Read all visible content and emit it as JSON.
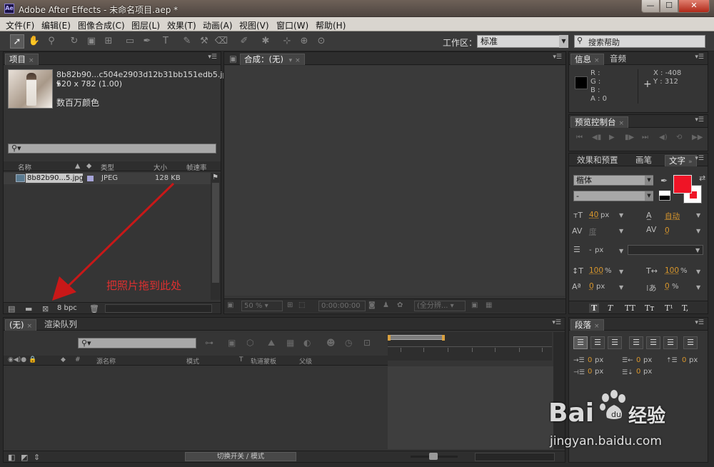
{
  "window": {
    "title": "Adobe After Effects - 未命名项目.aep *",
    "app_icon": "Ae",
    "min": "—",
    "max": "☐",
    "close": "✕"
  },
  "menu": [
    "文件(F)",
    "编辑(E)",
    "图像合成(C)",
    "图层(L)",
    "效果(T)",
    "动画(A)",
    "视图(V)",
    "窗口(W)",
    "帮助(H)"
  ],
  "toolbar": {
    "workspace_label": "工作区：",
    "workspace_value": "标准",
    "help_search": "搜索帮助"
  },
  "project": {
    "tab": "项目",
    "asset_name": "8b82b90...c504e2903d12b31bb151edb5.jpg ▾",
    "asset_dims": "520 x 782 (1.00)",
    "asset_color": "数百万颜色",
    "columns": [
      "名称",
      "类型",
      "大小",
      "帧速率"
    ],
    "row": {
      "name": "8b82b90...5.jpg",
      "type": "JPEG",
      "size": "128 KB"
    },
    "bpc": "8 bpc",
    "annotation": "把照片拖到此处",
    "annotation_color": "#c81818"
  },
  "comp": {
    "tab": "合成：(无)",
    "zoom": "50 %",
    "timecode": "0:00:00:00",
    "resolution": "(全分辨..."
  },
  "info": {
    "tab": "信息",
    "tab2": "音频",
    "r": "R :",
    "g": "G :",
    "b": "B :",
    "a": "A : 0",
    "x": "X : -408",
    "y": "Y : 312"
  },
  "preview": {
    "tab": "预览控制台"
  },
  "character": {
    "tab_effects": "效果和预置",
    "tab_brush": "画笔",
    "tab_text": "文字",
    "font": "楷体",
    "style": "-",
    "size_val": "40",
    "size_unit": "px",
    "leading_val": "自动",
    "kern_val": "度",
    "track_val": "0",
    "stroke_unit": "px",
    "vscale_val": "100",
    "vscale_unit": "%",
    "hscale_val": "100",
    "hscale_unit": "%",
    "baseline_val": "0",
    "baseline_unit": "px",
    "tsume_val": "0",
    "tsume_unit": "%",
    "styles": [
      "T",
      "T",
      "TT",
      "Tт",
      "T¹",
      "T,"
    ],
    "fill_color": "#ef1426"
  },
  "timeline": {
    "tab": "(无)",
    "tab2": "渲染队列",
    "columns": [
      "源名称",
      "模式",
      "T",
      "轨道蒙板",
      "父级"
    ],
    "switch_label": "切换开关 / 模式"
  },
  "paragraph": {
    "tab": "段落",
    "indent_val": "0",
    "indent_unit": "px"
  },
  "watermark": {
    "logo": "Bai",
    "logo2": "du",
    "text": "经验",
    "url": "jingyan.baidu.com"
  }
}
